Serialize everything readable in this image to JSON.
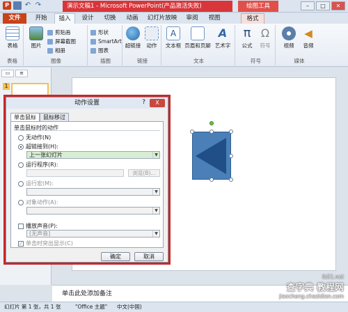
{
  "window": {
    "title": "演示文稿1 - Microsoft PowerPoint(产品激活失败)",
    "context_tool": "绘图工具"
  },
  "tabs": [
    {
      "label": "文件"
    },
    {
      "label": "开始"
    },
    {
      "label": "插入"
    },
    {
      "label": "设计"
    },
    {
      "label": "切换"
    },
    {
      "label": "动画"
    },
    {
      "label": "幻灯片放映"
    },
    {
      "label": "审阅"
    },
    {
      "label": "视图"
    },
    {
      "label": "格式"
    }
  ],
  "ribbon": {
    "groups": {
      "tables": "表格",
      "images": "图像",
      "illustrations": "插图",
      "links": "链接",
      "text": "文本",
      "symbols": "符号",
      "media": "媒体"
    },
    "buttons": {
      "table": "表格",
      "picture": "图片",
      "clipart": "剪贴画",
      "screenshot": "屏幕截图",
      "album": "相册",
      "shapes": "形状",
      "smartart": "SmartArt",
      "chart": "图表",
      "hyperlink": "超链接",
      "action": "动作",
      "textbox": "文本框",
      "header_footer": "页眉和页脚",
      "wordart": "艺术字",
      "equation": "公式",
      "symbol": "符号",
      "video": "视频",
      "audio": "音频"
    }
  },
  "left_panel": {
    "slide_number": "1"
  },
  "dialog": {
    "title": "动作设置",
    "help": "?",
    "close": "X",
    "tabs": [
      "单击鼠标",
      "鼠标移过"
    ],
    "group_title": "单击鼠标时的动作",
    "options": {
      "none": "无动作(N)",
      "hyperlink": "超链接到(H):",
      "hyperlink_value": "上一张幻灯片",
      "run_program": "运行程序(R):",
      "browse": "浏览(B)...",
      "run_macro": "运行宏(M):",
      "object_action": "对象动作(A):",
      "play_sound": "播放声音(P):",
      "sound_value": "[无声音]",
      "highlight": "单击时突出显示(C)"
    },
    "ok": "确定",
    "cancel": "取消"
  },
  "notes": {
    "placeholder": "单击此处添加备注"
  },
  "status": {
    "slide_info": "幻灯片 第 1 张，共 1 张",
    "theme": "\"Office 主题\"",
    "language": "中文(中国)"
  },
  "watermark": {
    "line1": "查字典 教程网",
    "line2": "jiaocheng.chazidian.com",
    "corner": "ib51.net"
  },
  "colors": {
    "accent": "#c8421a",
    "highlight_red": "#c62828",
    "shape_fill": "#4a7fb8"
  }
}
